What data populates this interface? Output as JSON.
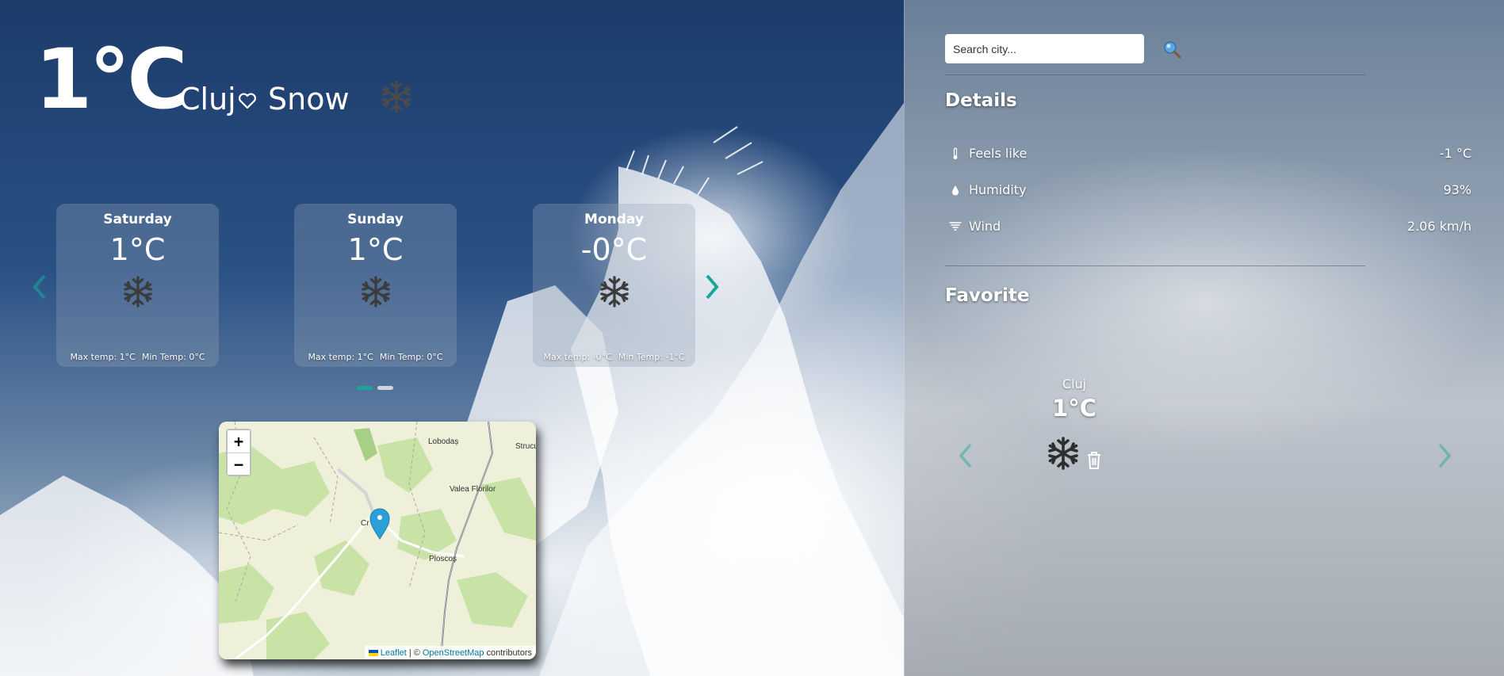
{
  "current": {
    "temperature": "1°C",
    "city": "Cluj",
    "condition": "Snow",
    "icon": "snowflake-icon"
  },
  "forecast": {
    "days": [
      {
        "day": "Saturday",
        "temp": "1°C",
        "max": "Max temp: 1°C",
        "min": "Min Temp: 0°C",
        "icon": "snowflake-icon"
      },
      {
        "day": "Sunday",
        "temp": "1°C",
        "max": "Max temp: 1°C",
        "min": "Min Temp: 0°C",
        "icon": "snowflake-icon"
      },
      {
        "day": "Monday",
        "temp": "-0°C",
        "max": "Max temp: -0°C",
        "min": "Min Temp: -1°C",
        "icon": "snowflake-icon"
      }
    ],
    "page_count": 2,
    "active_page": 1
  },
  "map": {
    "places": [
      "Lobodaș",
      "Strucuț",
      "Valea Florilor",
      "Cr",
      "Ploscoș"
    ],
    "zoom_in": "+",
    "zoom_out": "−",
    "attribution": {
      "leaflet": "Leaflet",
      "separator": "| ©",
      "osm": "OpenStreetMap",
      "contributors": "contributors"
    }
  },
  "panel": {
    "search": {
      "placeholder": "Search city...",
      "value": ""
    },
    "details": {
      "title": "Details",
      "rows": [
        {
          "icon": "thermometer-icon",
          "label": "Feels like",
          "value": "-1 °C"
        },
        {
          "icon": "droplet-icon",
          "label": "Humidity",
          "value": "93%"
        },
        {
          "icon": "wind-icon",
          "label": "Wind",
          "value": "2.06 km/h"
        }
      ]
    },
    "favorite": {
      "title": "Favorite",
      "items": [
        {
          "city": "Cluj",
          "temp": "1°C",
          "icon": "snowflake-icon"
        }
      ]
    }
  },
  "colors": {
    "accent": "#1aa59a",
    "dot_inactive": "#cfd5dc",
    "snowflake_dark": "#3c3c3c",
    "panel_divider": "#5a6470"
  }
}
